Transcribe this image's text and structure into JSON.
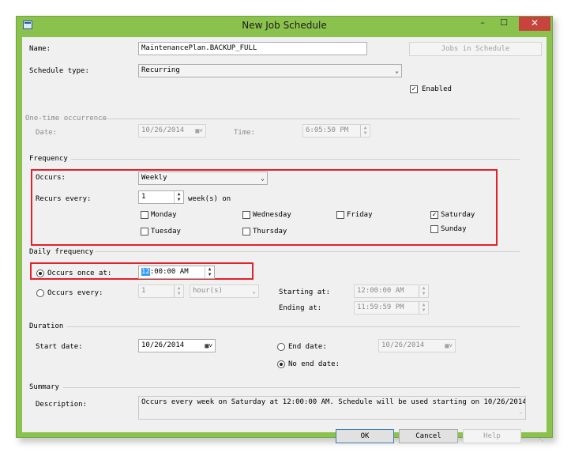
{
  "window": {
    "title": "New Job Schedule",
    "minimize": "–",
    "maximize": "☐",
    "close": "✕"
  },
  "name": {
    "label": "Name:",
    "value": "MaintenancePlan.BACKUP_FULL",
    "jobs_button": "Jobs in Schedule"
  },
  "schedule_type": {
    "label": "Schedule type:",
    "value": "Recurring",
    "enabled_label": "Enabled",
    "enabled_checked": true
  },
  "one_time": {
    "section": "One-time occurrence",
    "date_label": "Date:",
    "date_value": "10/26/2014",
    "time_label": "Time:",
    "time_value": "6:05:50 PM"
  },
  "frequency": {
    "section": "Frequency",
    "occurs_label": "Occurs:",
    "occurs_value": "Weekly",
    "recurs_label": "Recurs every:",
    "recurs_value": "1",
    "recurs_suffix": "week(s) on",
    "days": {
      "monday": "Monday",
      "tuesday": "Tuesday",
      "wednesday": "Wednesday",
      "thursday": "Thursday",
      "friday": "Friday",
      "saturday": "Saturday",
      "sunday": "Sunday"
    },
    "saturday_checked": true
  },
  "daily": {
    "section": "Daily frequency",
    "once_label": "Occurs once at:",
    "once_value": "12:00:00 AM",
    "once_selected_part": "12",
    "every_label": "Occurs every:",
    "every_value": "1",
    "every_unit": "hour(s)",
    "starting_label": "Starting at:",
    "starting_value": "12:00:00 AM",
    "ending_label": "Ending at:",
    "ending_value": "11:59:59 PM"
  },
  "duration": {
    "section": "Duration",
    "start_label": "Start date:",
    "start_value": "10/26/2014",
    "end_label": "End date:",
    "end_value": "10/26/2014",
    "no_end_label": "No end date:"
  },
  "summary": {
    "section": "Summary",
    "desc_label": "Description:",
    "description": "Occurs every week on Saturday at 12:00:00 AM. Schedule will be used starting on 10/26/2014."
  },
  "buttons": {
    "ok": "OK",
    "cancel": "Cancel",
    "help": "Help"
  },
  "colors": {
    "accent": "#8bc24e",
    "highlight": "#e0222b",
    "close": "#c7433d",
    "selection": "#3399ff"
  }
}
